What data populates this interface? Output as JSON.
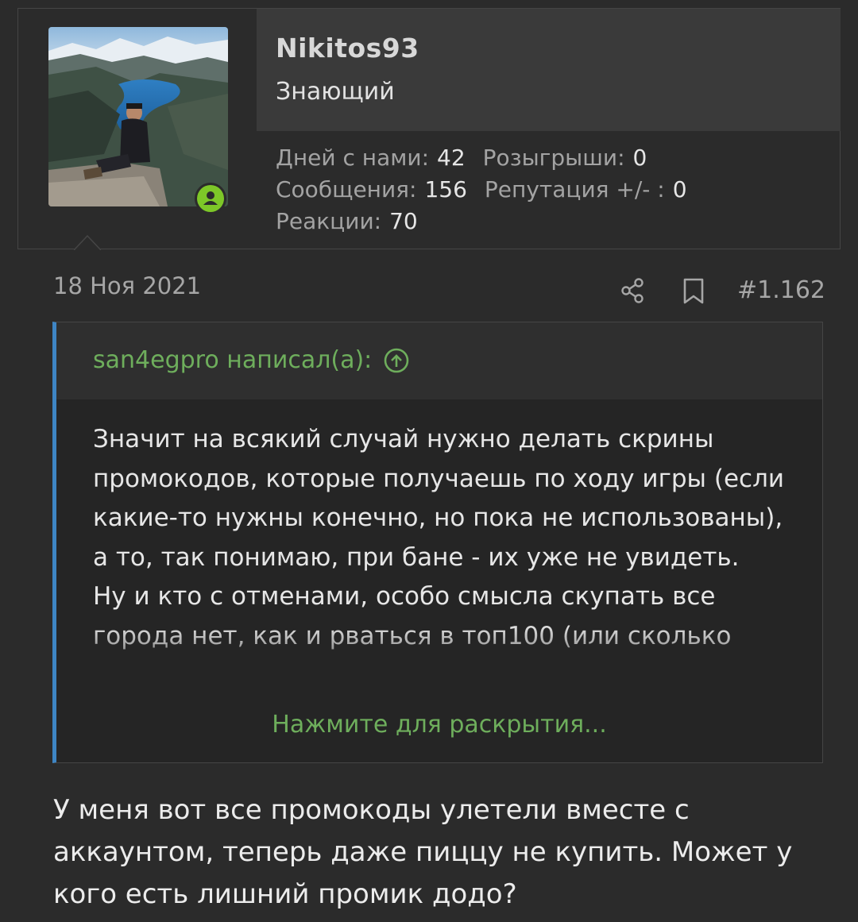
{
  "user": {
    "name": "Nikitos93",
    "title": "Знающий",
    "stats": {
      "days_label": "Дней с нами:",
      "days_value": "42",
      "giveaways_label": "Розыгрыши:",
      "giveaways_value": "0",
      "messages_label": "Сообщения:",
      "messages_value": "156",
      "reputation_label": "Репутация +/- :",
      "reputation_value": "0",
      "reactions_label": "Реакции:",
      "reactions_value": "70"
    },
    "online_icon": "user-online-icon"
  },
  "post": {
    "date": "18 Ноя 2021",
    "number": "#1.162",
    "share_icon": "share-icon",
    "bookmark_icon": "bookmark-icon"
  },
  "quote": {
    "author": "san4egpro написал(а):",
    "paragraph1": "Значит на всякий случай нужно делать скрины промокодов, которые получаешь по ходу игры (если какие-то нужны конечно, но пока не использованы), а то, так понимаю, при бане - их уже не увидеть.",
    "paragraph2": "Ну и кто с отменами, особо смысла скупать все города нет, как и рваться в топ100 (или сколько",
    "expand_label": "Нажмите для раскрытия..."
  },
  "reply": {
    "text": "У меня вот все промокоды улетели вместе с аккаунтом, теперь даже пиццу не купить. Может у кого есть лишний промик додо?"
  },
  "colors": {
    "background": "#2b2b2b",
    "accent_green": "#6eae5c",
    "quote_border": "#3e85c4",
    "online_badge": "#7dc728"
  }
}
